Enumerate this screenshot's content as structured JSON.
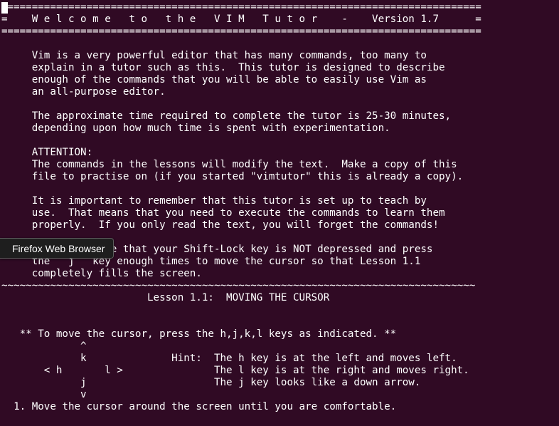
{
  "terminal": {
    "lines": [
      "===============================================================================",
      "=    W e l c o m e   t o   t h e   V I M   T u t o r    -    Version 1.7      =",
      "===============================================================================",
      "",
      "     Vim is a very powerful editor that has many commands, too many to",
      "     explain in a tutor such as this.  This tutor is designed to describe",
      "     enough of the commands that you will be able to easily use Vim as",
      "     an all-purpose editor.",
      "",
      "     The approximate time required to complete the tutor is 25-30 minutes,",
      "     depending upon how much time is spent with experimentation.",
      "",
      "     ATTENTION:",
      "     The commands in the lessons will modify the text.  Make a copy of this",
      "     file to practise on (if you started \"vimtutor\" this is already a copy).",
      "",
      "     It is important to remember that this tutor is set up to teach by",
      "     use.  That means that you need to execute the commands to learn them",
      "     properly.  If you only read the text, you will forget the commands!",
      "",
      "     Now, make sure that your Shift-Lock key is NOT depressed and press",
      "     the   j   key enough times to move the cursor so that Lesson 1.1",
      "     completely fills the screen.",
      "~~~~~~~~~~~~~~~~~~~~~~~~~~~~~~~~~~~~~~~~~~~~~~~~~~~~~~~~~~~~~~~~~~~~~~~~~~~~~~",
      "                        Lesson 1.1:  MOVING THE CURSOR",
      "",
      "",
      "   ** To move the cursor, press the h,j,k,l keys as indicated. **",
      "             ^",
      "             k              Hint:  The h key is at the left and moves left.",
      "       < h       l >               The l key is at the right and moves right.",
      "             j                     The j key looks like a down arrow.",
      "             v",
      "  1. Move the cursor around the screen until you are comfortable."
    ]
  },
  "tooltip": {
    "label": "Firefox Web Browser"
  }
}
